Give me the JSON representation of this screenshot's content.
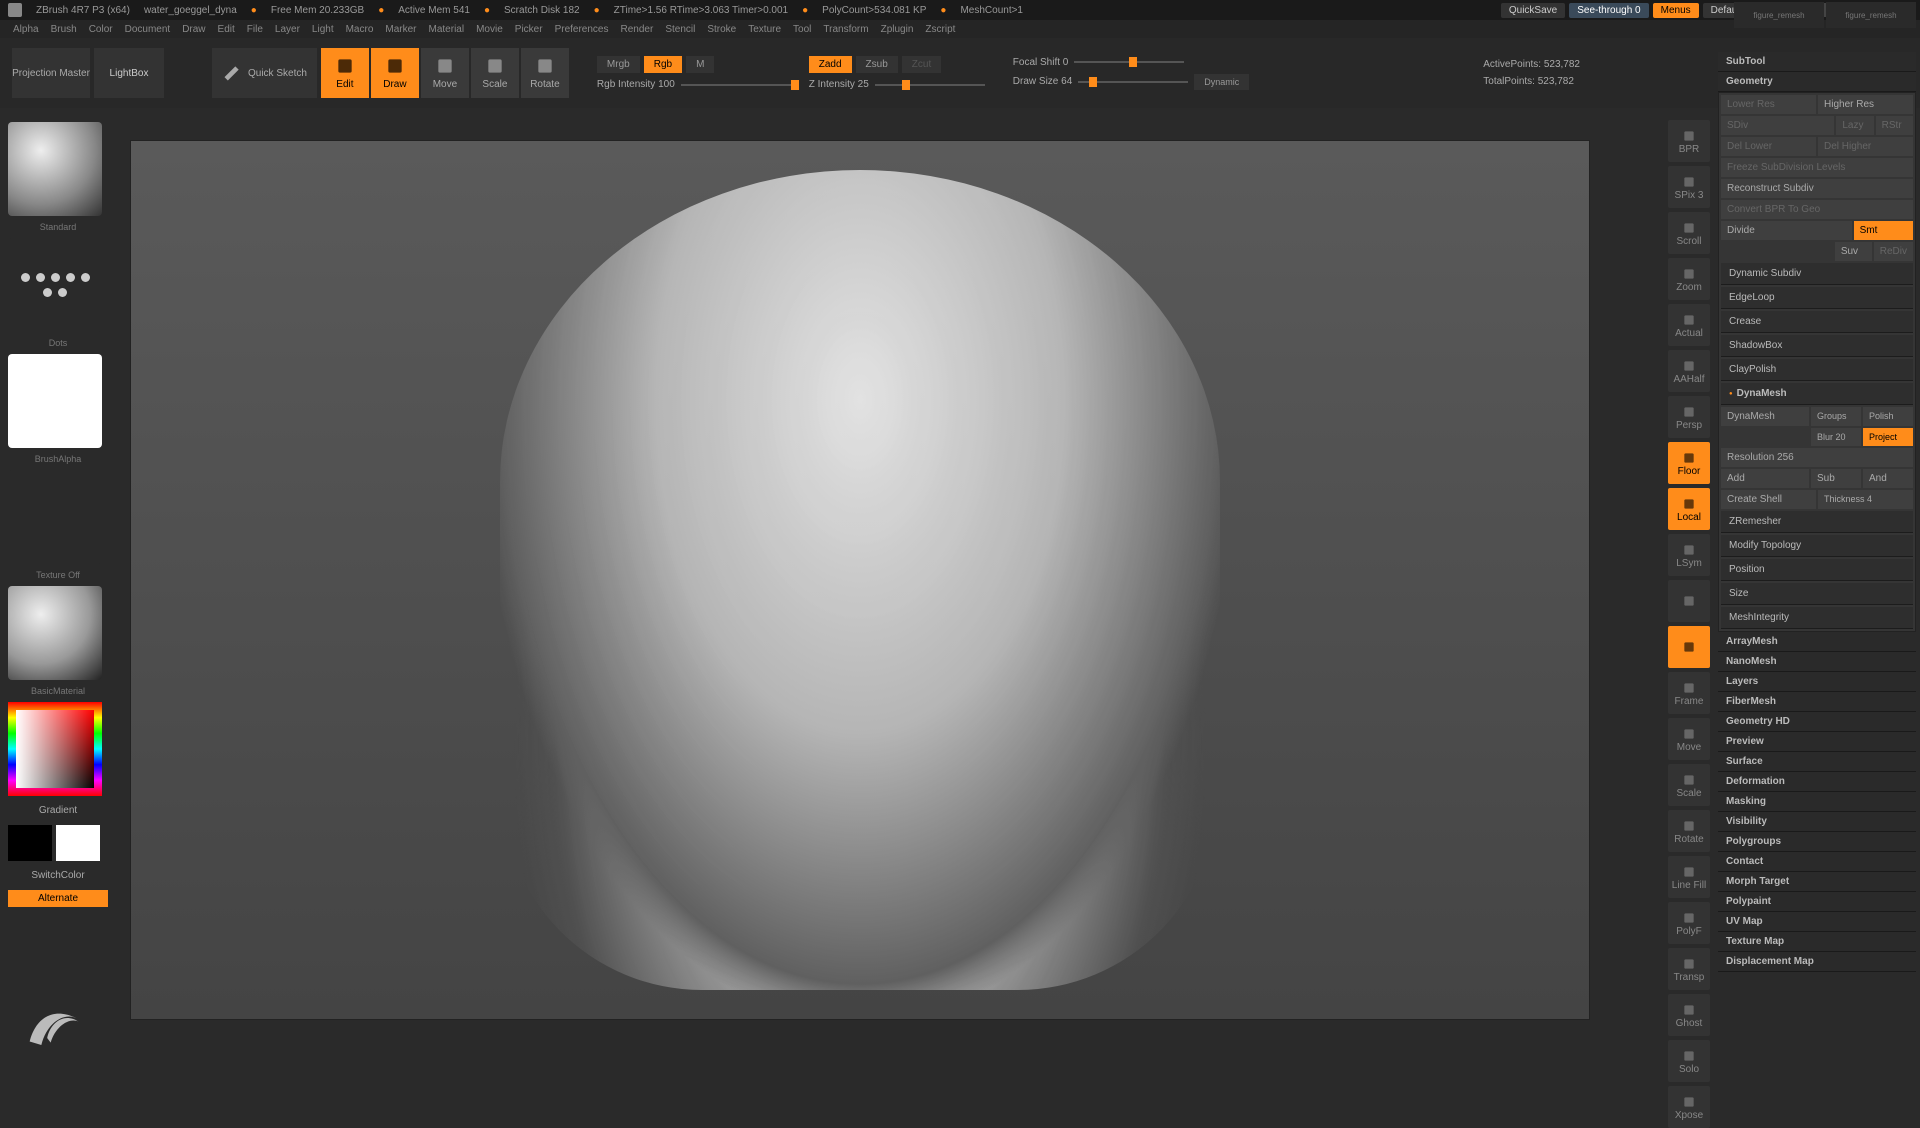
{
  "titlebar": {
    "app": "ZBrush 4R7 P3 (x64)",
    "doc": "water_goeggel_dyna",
    "free_mem": "Free Mem 20.233GB",
    "active_mem": "Active Mem 541",
    "scratch": "Scratch Disk 182",
    "ztime": "ZTime>1.56 RTime>3.063 Timer>0.001",
    "polycount": "PolyCount>534.081 KP",
    "meshcount": "MeshCount>1",
    "quicksave": "QuickSave",
    "seethrough": "See-through  0",
    "menus": "Menus",
    "script": "DefaultZScript"
  },
  "menubar": [
    "Alpha",
    "Brush",
    "Color",
    "Document",
    "Draw",
    "Edit",
    "File",
    "Layer",
    "Light",
    "Macro",
    "Marker",
    "Material",
    "Movie",
    "Picker",
    "Preferences",
    "Render",
    "Stencil",
    "Stroke",
    "Texture",
    "Tool",
    "Transform",
    "Zplugin",
    "Zscript"
  ],
  "toolbar": {
    "projection": "Projection Master",
    "lightbox": "LightBox",
    "quicksketch": "Quick Sketch",
    "modes": [
      "Edit",
      "Draw",
      "Move",
      "Scale",
      "Rotate"
    ],
    "mrgb": "Mrgb",
    "rgb": "Rgb",
    "m": "M",
    "rgb_intensity": "Rgb Intensity 100",
    "zadd": "Zadd",
    "zsub": "Zsub",
    "zcut": "Zcut",
    "z_intensity": "Z Intensity 25",
    "focal_shift": "Focal Shift 0",
    "draw_size": "Draw Size 64",
    "dynamic": "Dynamic",
    "active_points": "ActivePoints: 523,782",
    "total_points": "TotalPoints: 523,782"
  },
  "left": {
    "standard": "Standard",
    "dots": "Dots",
    "alpha": "BrushAlpha",
    "texture": "Texture Off",
    "material": "BasicMaterial",
    "gradient": "Gradient",
    "switchcolor": "SwitchColor",
    "alternate": "Alternate"
  },
  "right_btns": [
    "BPR",
    "SPix 3",
    "Scroll",
    "Zoom",
    "Actual",
    "AAHalf",
    "Persp",
    "Floor",
    "Local",
    "LSym",
    "",
    "",
    "Frame",
    "Move",
    "Scale",
    "Rotate",
    "Line Fill",
    "PolyF",
    "Transp",
    "Ghost",
    "Solo",
    "Xpose"
  ],
  "panel": {
    "subtool": "SubTool",
    "geometry": "Geometry",
    "lower_res": "Lower Res",
    "higher_res": "Higher Res",
    "sdiv": "SDiv",
    "lazy": "Lazy",
    "rstr": "RStr",
    "del_lower": "Del Lower",
    "del_higher": "Del Higher",
    "freeze": "Freeze SubDivision Levels",
    "reconstruct": "Reconstruct Subdiv",
    "convert": "Convert BPR To Geo",
    "divide": "Divide",
    "smt": "Smt",
    "suv": "Suv",
    "rediv": "ReDiv",
    "dynamic_subdiv": "Dynamic Subdiv",
    "edgeloop": "EdgeLoop",
    "crease": "Crease",
    "shadowbox": "ShadowBox",
    "claypolish": "ClayPolish",
    "dynamesh_hdr": "DynaMesh",
    "dynamesh_btn": "DynaMesh",
    "groups": "Groups",
    "polish": "Polish",
    "blur": "Blur 20",
    "project": "Project",
    "resolution": "Resolution 256",
    "add": "Add",
    "sub": "Sub",
    "and": "And",
    "create_shell": "Create Shell",
    "thickness": "Thickness 4",
    "zremesher": "ZRemesher",
    "modify_topology": "Modify Topology",
    "position": "Position",
    "size": "Size",
    "meshintegrity": "MeshIntegrity",
    "array": "ArrayMesh",
    "nano": "NanoMesh",
    "layers": "Layers",
    "fiber": "FiberMesh",
    "geohd": "Geometry HD",
    "preview": "Preview",
    "surface": "Surface",
    "deformation": "Deformation",
    "masking": "Masking",
    "visibility": "Visibility",
    "polygroups": "Polygroups",
    "contact": "Contact",
    "morph": "Morph Target",
    "polypaint": "Polypaint",
    "uvmap": "UV Map",
    "texturemap": "Texture Map",
    "displacement": "Displacement Map"
  },
  "corner": [
    "figure_remesh",
    "figure_remesh"
  ]
}
